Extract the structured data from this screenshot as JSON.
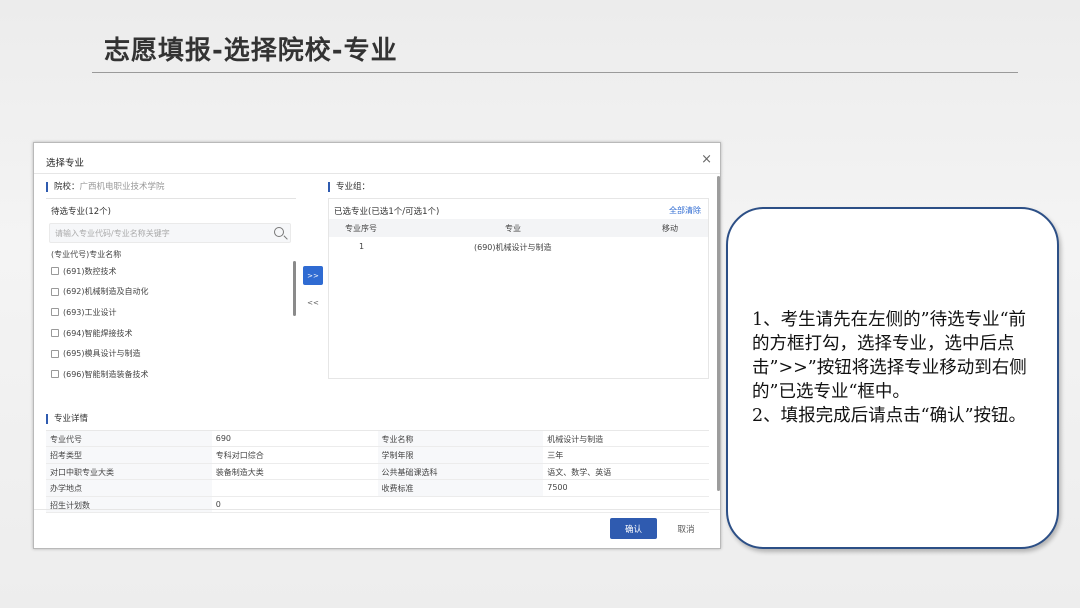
{
  "slide": {
    "title": "志愿填报-选择院校-专业"
  },
  "dialog": {
    "title": "选择专业",
    "close_symbol": "×",
    "school_label": "院校：",
    "school_name": "广西机电职业技术学院",
    "group_label": "专业组：",
    "waiting_label": "待选专业(12个)",
    "search_placeholder": "请输入专业代码/专业名称关键字",
    "list_header": "(专业代号)专业名称",
    "majors": [
      "(691)数控技术",
      "(692)机械制造及自动化",
      "(693)工业设计",
      "(694)智能焊接技术",
      "(695)模具设计与制造",
      "(696)智能制造装备技术"
    ],
    "move_right_label": ">>",
    "move_left_label": "<<",
    "selected_label": "已选专业(已选1个/可选1个)",
    "clear_all_label": "全部清除",
    "selected_table": {
      "headers": [
        "专业序号",
        "专业",
        "移动"
      ],
      "rows": [
        {
          "index": "1",
          "major": "(690)机械设计与制造",
          "move": ""
        }
      ]
    },
    "detail_label": "专业详情",
    "details": [
      [
        "专业代号",
        "690",
        "专业名称",
        "机械设计与制造"
      ],
      [
        "招考类型",
        "专科对口综合",
        "学制年限",
        "三年"
      ],
      [
        "对口中职专业大类",
        "装备制造大类",
        "公共基础课选科",
        "语文、数学、英语"
      ],
      [
        "办学地点",
        "",
        "收费标准",
        "7500"
      ],
      [
        "招生计划数",
        "0",
        "",
        ""
      ]
    ],
    "confirm_label": "确认",
    "cancel_label": "取消"
  },
  "note": {
    "lines": [
      "1、考生请先在左侧的”待选专业“前的方框打勾，选择专业，选中后点击”>>”按钮将选择专业移动到右侧的”已选专业“框中。",
      "2、填报完成后请点击“确认”按钮。"
    ]
  },
  "colors": {
    "accent_blue": "#2f5bb0",
    "note_border": "#2c4f86"
  }
}
